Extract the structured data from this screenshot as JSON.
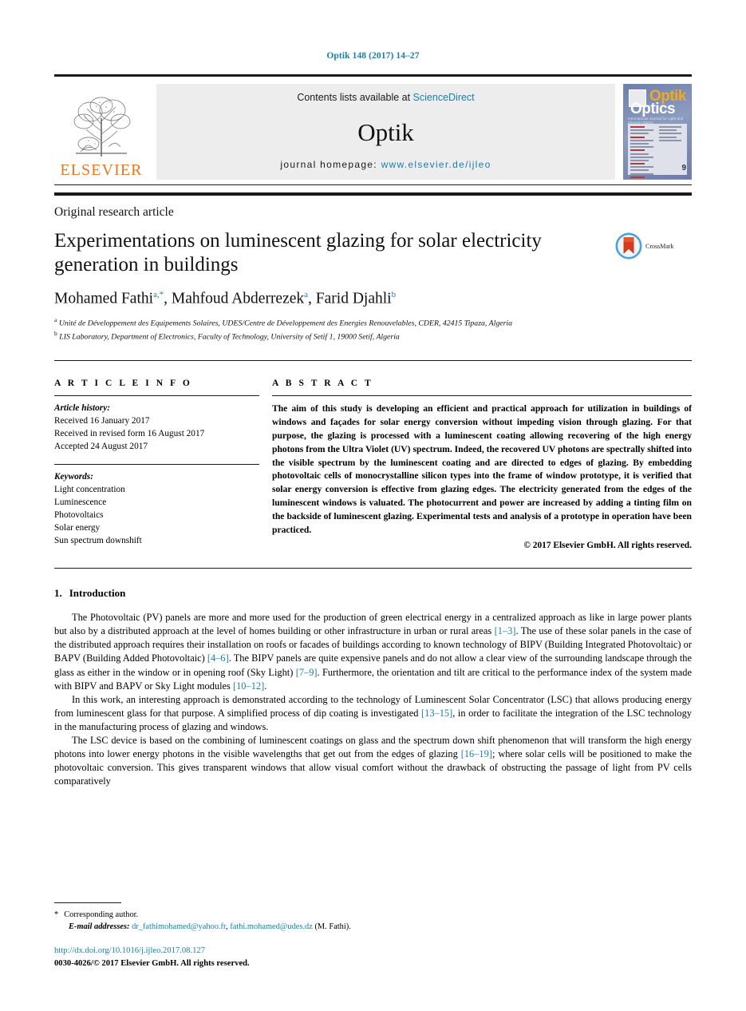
{
  "running_head": "Optik 148 (2017) 14–27",
  "masthead": {
    "contents_prefix": "Contents lists available at ",
    "contents_link": "ScienceDirect",
    "journal_name": "Optik",
    "homepage_label": "journal homepage:",
    "homepage_url": "www.elsevier.de/ijleo",
    "publisher": "ELSEVIER",
    "cover": {
      "title_top": "Optik",
      "title_bottom": "Optics",
      "subtitle": "International Journal for Light and Electron Optics",
      "issue_number": "9"
    }
  },
  "article": {
    "type": "Original research article",
    "title": "Experimentations on luminescent glazing for solar electricity generation in buildings",
    "crossmark_label": "CrossMark",
    "authors_html": "Mohamed Fathi<sup>a,*</sup>, Mahfoud Abderrezek<sup>a</sup>, Farid Djahli<sup>b</sup>",
    "affiliations": [
      "Unité de Développement des Equipements Solaires, UDES/Centre de Développement des Energies Renouvelables, CDER, 42415 Tipaza, Algeria",
      "LIS Laboratory, Department of Electronics, Faculty of Technology, University of Setif 1, 19000 Setif, Algeria"
    ],
    "affiliation_marks": [
      "a",
      "b"
    ]
  },
  "article_info": {
    "heading": "A R T I C L E   I N F O",
    "history_label": "Article history:",
    "history": [
      "Received 16 January 2017",
      "Received in revised form 16 August 2017",
      "Accepted 24 August 2017"
    ],
    "keywords_label": "Keywords:",
    "keywords": [
      "Light concentration",
      "Luminescence",
      "Photovoltaics",
      "Solar energy",
      "Sun spectrum downshift"
    ]
  },
  "abstract": {
    "heading": "A B S T R A C T",
    "text": "The aim of this study is developing an efficient and practical approach for utilization in buildings of windows and façades for solar energy conversion without impeding vision through glazing. For that purpose, the glazing is processed with a luminescent coating allowing recovering of the high energy photons from the Ultra Violet (UV) spectrum. Indeed, the recovered UV photons are spectrally shifted into the visible spectrum by the luminescent coating and are directed to edges of glazing. By embedding photovoltaic cells of monocrystalline silicon types into the frame of window prototype, it is verified that solar energy conversion is effective from glazing edges. The electricity generated from the edges of the luminescent windows is valuated. The photocurrent and power are increased by adding a tinting film on the backside of luminescent glazing. Experimental tests and analysis of a prototype in operation have been practiced.",
    "copyright": "© 2017 Elsevier GmbH. All rights reserved."
  },
  "body": {
    "section_number": "1.",
    "section_title": "Introduction",
    "paragraphs": [
      {
        "parts": [
          {
            "t": "The Photovoltaic (PV) panels are more and more used for the production of green electrical energy in a centralized approach as like in large power plants but also by a distributed approach at the level of homes building or other infrastructure in urban or rural areas "
          },
          {
            "t": "[1–3]",
            "ref": true
          },
          {
            "t": ". The use of these solar panels in the case of the distributed approach requires their installation on roofs or facades of buildings according to known technology of BIPV (Building Integrated Photovoltaic) or BAPV (Building Added Photovoltaic) "
          },
          {
            "t": "[4–6]",
            "ref": true
          },
          {
            "t": ". The BIPV panels are quite expensive panels and do not allow a clear view of the surrounding landscape through the glass as either in the window or in opening roof (Sky Light) "
          },
          {
            "t": "[7–9]",
            "ref": true
          },
          {
            "t": ". Furthermore, the orientation and tilt are critical to the performance index of the system made with BIPV and BAPV or Sky Light modules "
          },
          {
            "t": "[10–12]",
            "ref": true
          },
          {
            "t": "."
          }
        ]
      },
      {
        "parts": [
          {
            "t": "In this work, an interesting approach is demonstrated according to the technology of Luminescent Solar Concentrator (LSC) that allows producing energy from luminescent glass for that purpose. A simplified process of dip coating is investigated "
          },
          {
            "t": "[13–15]",
            "ref": true
          },
          {
            "t": ", in order to facilitate the integration of the LSC technology in the manufacturing process of glazing and windows."
          }
        ]
      },
      {
        "parts": [
          {
            "t": "The LSC device is based on the combining of luminescent coatings on glass and the spectrum down shift phenomenon that will transform the high energy photons into lower energy photons in the visible wavelengths that get out from the edges of glazing "
          },
          {
            "t": "[16–19]",
            "ref": true
          },
          {
            "t": "; where solar cells will be positioned to make the photovoltaic conversion. This gives transparent windows that allow visual comfort without the drawback of obstructing the passage of light from PV cells comparatively"
          }
        ]
      }
    ]
  },
  "footer": {
    "corresponding_star": "*",
    "corresponding_label": "Corresponding author.",
    "email_label": "E-mail addresses:",
    "email_1": "dr_fathimohamed@yahoo.fr",
    "email_sep": ", ",
    "email_2": "fathi.mohamed@udes.dz",
    "email_owner": " (M. Fathi).",
    "doi": "http://dx.doi.org/10.1016/j.ijleo.2017.08.127",
    "issn_line": "0030-4026/© 2017 Elsevier GmbH. All rights reserved."
  },
  "colors": {
    "link": "#1a7fa8",
    "elsevier_orange": "#E87722",
    "band_gray": "#ededed"
  }
}
